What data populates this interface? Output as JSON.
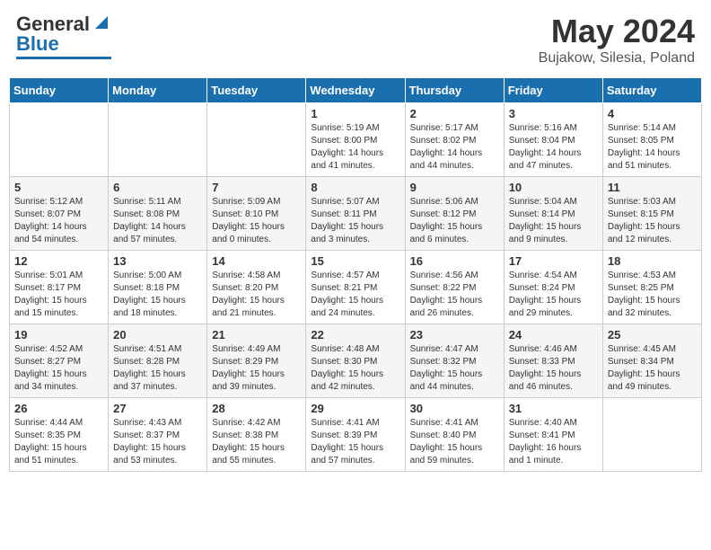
{
  "header": {
    "logo_general": "General",
    "logo_blue": "Blue",
    "month_year": "May 2024",
    "location": "Bujakow, Silesia, Poland"
  },
  "weekdays": [
    "Sunday",
    "Monday",
    "Tuesday",
    "Wednesday",
    "Thursday",
    "Friday",
    "Saturday"
  ],
  "weeks": [
    [
      {
        "day": "",
        "sunrise": "",
        "sunset": "",
        "daylight": ""
      },
      {
        "day": "",
        "sunrise": "",
        "sunset": "",
        "daylight": ""
      },
      {
        "day": "",
        "sunrise": "",
        "sunset": "",
        "daylight": ""
      },
      {
        "day": "1",
        "sunrise": "Sunrise: 5:19 AM",
        "sunset": "Sunset: 8:00 PM",
        "daylight": "Daylight: 14 hours and 41 minutes."
      },
      {
        "day": "2",
        "sunrise": "Sunrise: 5:17 AM",
        "sunset": "Sunset: 8:02 PM",
        "daylight": "Daylight: 14 hours and 44 minutes."
      },
      {
        "day": "3",
        "sunrise": "Sunrise: 5:16 AM",
        "sunset": "Sunset: 8:04 PM",
        "daylight": "Daylight: 14 hours and 47 minutes."
      },
      {
        "day": "4",
        "sunrise": "Sunrise: 5:14 AM",
        "sunset": "Sunset: 8:05 PM",
        "daylight": "Daylight: 14 hours and 51 minutes."
      }
    ],
    [
      {
        "day": "5",
        "sunrise": "Sunrise: 5:12 AM",
        "sunset": "Sunset: 8:07 PM",
        "daylight": "Daylight: 14 hours and 54 minutes."
      },
      {
        "day": "6",
        "sunrise": "Sunrise: 5:11 AM",
        "sunset": "Sunset: 8:08 PM",
        "daylight": "Daylight: 14 hours and 57 minutes."
      },
      {
        "day": "7",
        "sunrise": "Sunrise: 5:09 AM",
        "sunset": "Sunset: 8:10 PM",
        "daylight": "Daylight: 15 hours and 0 minutes."
      },
      {
        "day": "8",
        "sunrise": "Sunrise: 5:07 AM",
        "sunset": "Sunset: 8:11 PM",
        "daylight": "Daylight: 15 hours and 3 minutes."
      },
      {
        "day": "9",
        "sunrise": "Sunrise: 5:06 AM",
        "sunset": "Sunset: 8:12 PM",
        "daylight": "Daylight: 15 hours and 6 minutes."
      },
      {
        "day": "10",
        "sunrise": "Sunrise: 5:04 AM",
        "sunset": "Sunset: 8:14 PM",
        "daylight": "Daylight: 15 hours and 9 minutes."
      },
      {
        "day": "11",
        "sunrise": "Sunrise: 5:03 AM",
        "sunset": "Sunset: 8:15 PM",
        "daylight": "Daylight: 15 hours and 12 minutes."
      }
    ],
    [
      {
        "day": "12",
        "sunrise": "Sunrise: 5:01 AM",
        "sunset": "Sunset: 8:17 PM",
        "daylight": "Daylight: 15 hours and 15 minutes."
      },
      {
        "day": "13",
        "sunrise": "Sunrise: 5:00 AM",
        "sunset": "Sunset: 8:18 PM",
        "daylight": "Daylight: 15 hours and 18 minutes."
      },
      {
        "day": "14",
        "sunrise": "Sunrise: 4:58 AM",
        "sunset": "Sunset: 8:20 PM",
        "daylight": "Daylight: 15 hours and 21 minutes."
      },
      {
        "day": "15",
        "sunrise": "Sunrise: 4:57 AM",
        "sunset": "Sunset: 8:21 PM",
        "daylight": "Daylight: 15 hours and 24 minutes."
      },
      {
        "day": "16",
        "sunrise": "Sunrise: 4:56 AM",
        "sunset": "Sunset: 8:22 PM",
        "daylight": "Daylight: 15 hours and 26 minutes."
      },
      {
        "day": "17",
        "sunrise": "Sunrise: 4:54 AM",
        "sunset": "Sunset: 8:24 PM",
        "daylight": "Daylight: 15 hours and 29 minutes."
      },
      {
        "day": "18",
        "sunrise": "Sunrise: 4:53 AM",
        "sunset": "Sunset: 8:25 PM",
        "daylight": "Daylight: 15 hours and 32 minutes."
      }
    ],
    [
      {
        "day": "19",
        "sunrise": "Sunrise: 4:52 AM",
        "sunset": "Sunset: 8:27 PM",
        "daylight": "Daylight: 15 hours and 34 minutes."
      },
      {
        "day": "20",
        "sunrise": "Sunrise: 4:51 AM",
        "sunset": "Sunset: 8:28 PM",
        "daylight": "Daylight: 15 hours and 37 minutes."
      },
      {
        "day": "21",
        "sunrise": "Sunrise: 4:49 AM",
        "sunset": "Sunset: 8:29 PM",
        "daylight": "Daylight: 15 hours and 39 minutes."
      },
      {
        "day": "22",
        "sunrise": "Sunrise: 4:48 AM",
        "sunset": "Sunset: 8:30 PM",
        "daylight": "Daylight: 15 hours and 42 minutes."
      },
      {
        "day": "23",
        "sunrise": "Sunrise: 4:47 AM",
        "sunset": "Sunset: 8:32 PM",
        "daylight": "Daylight: 15 hours and 44 minutes."
      },
      {
        "day": "24",
        "sunrise": "Sunrise: 4:46 AM",
        "sunset": "Sunset: 8:33 PM",
        "daylight": "Daylight: 15 hours and 46 minutes."
      },
      {
        "day": "25",
        "sunrise": "Sunrise: 4:45 AM",
        "sunset": "Sunset: 8:34 PM",
        "daylight": "Daylight: 15 hours and 49 minutes."
      }
    ],
    [
      {
        "day": "26",
        "sunrise": "Sunrise: 4:44 AM",
        "sunset": "Sunset: 8:35 PM",
        "daylight": "Daylight: 15 hours and 51 minutes."
      },
      {
        "day": "27",
        "sunrise": "Sunrise: 4:43 AM",
        "sunset": "Sunset: 8:37 PM",
        "daylight": "Daylight: 15 hours and 53 minutes."
      },
      {
        "day": "28",
        "sunrise": "Sunrise: 4:42 AM",
        "sunset": "Sunset: 8:38 PM",
        "daylight": "Daylight: 15 hours and 55 minutes."
      },
      {
        "day": "29",
        "sunrise": "Sunrise: 4:41 AM",
        "sunset": "Sunset: 8:39 PM",
        "daylight": "Daylight: 15 hours and 57 minutes."
      },
      {
        "day": "30",
        "sunrise": "Sunrise: 4:41 AM",
        "sunset": "Sunset: 8:40 PM",
        "daylight": "Daylight: 15 hours and 59 minutes."
      },
      {
        "day": "31",
        "sunrise": "Sunrise: 4:40 AM",
        "sunset": "Sunset: 8:41 PM",
        "daylight": "Daylight: 16 hours and 1 minute."
      },
      {
        "day": "",
        "sunrise": "",
        "sunset": "",
        "daylight": ""
      }
    ]
  ]
}
